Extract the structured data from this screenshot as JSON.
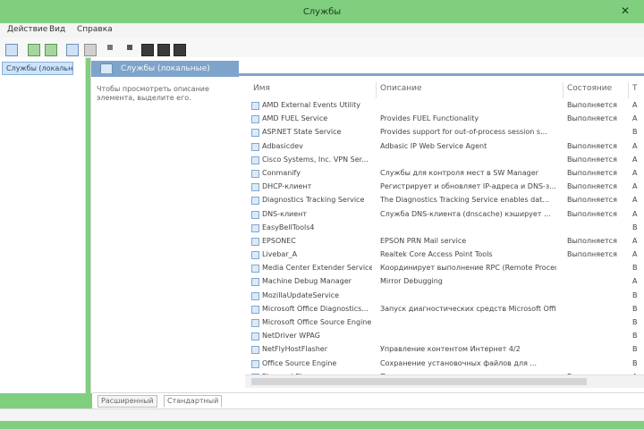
{
  "window": {
    "title": "Службы",
    "menu": [
      "Действие",
      "Вид",
      "Справка"
    ]
  },
  "left_pane": {
    "selected_item": "Службы (локальные)"
  },
  "main": {
    "header": "Службы (локальные)",
    "description": "Чтобы просмотреть описание элемента, выделите его.",
    "columns": [
      "Имя",
      "Описание",
      "Состояние",
      "Т"
    ],
    "rows": [
      {
        "name": "AMD External Events Utility",
        "desc": "",
        "state": "Выполняется",
        "extra": "А"
      },
      {
        "name": "AMD FUEL Service",
        "desc": "Provides FUEL Functionality",
        "state": "Выполняется",
        "extra": "А"
      },
      {
        "name": "ASP.NET State Service",
        "desc": "Provides support for out-of-process session s...",
        "state": "",
        "extra": "В"
      },
      {
        "name": "Adbasicdev",
        "desc": "Adbasic IP Web Service Agent",
        "state": "Выполняется",
        "extra": "А"
      },
      {
        "name": "Cisco Systems, Inc. VPN Ser...",
        "desc": "",
        "state": "Выполняется",
        "extra": "А"
      },
      {
        "name": "Conmanify",
        "desc": "Службы для контроля мест в SW Manager",
        "state": "Выполняется",
        "extra": "А"
      },
      {
        "name": "DHCP-клиент",
        "desc": "Регистрирует и обновляет IP-адреса и DNS-з...",
        "state": "Выполняется",
        "extra": "А"
      },
      {
        "name": "Diagnostics Tracking Service",
        "desc": "The Diagnostics Tracking Service enables dat...",
        "state": "Выполняется",
        "extra": "А"
      },
      {
        "name": "DNS-клиент",
        "desc": "Служба DNS-клиента (dnscache) кэширует ...",
        "state": "Выполняется",
        "extra": "А"
      },
      {
        "name": "EasyBellTools4",
        "desc": "",
        "state": "",
        "extra": "В"
      },
      {
        "name": "EPSONEC",
        "desc": "EPSON PRN Mail service",
        "state": "Выполняется",
        "extra": "А"
      },
      {
        "name": "Livebar_A",
        "desc": "Realtek Core Access Point Tools",
        "state": "Выполняется",
        "extra": "А"
      },
      {
        "name": "Media Center Extender Service",
        "desc": "Координирует выполнение RPC (Remote Procedure Call) ...",
        "state": "",
        "extra": "В"
      },
      {
        "name": "Machine Debug Manager",
        "desc": "Mirror Debugging",
        "state": "",
        "extra": "А"
      },
      {
        "name": "MozillaUpdateService",
        "desc": "",
        "state": "",
        "extra": "В"
      },
      {
        "name": "Microsoft Office Diagnostics...",
        "desc": "Запуск диагностических средств Microsoft Office",
        "state": "",
        "extra": "В"
      },
      {
        "name": "Microsoft Office Source Engine",
        "desc": "",
        "state": "",
        "extra": "В"
      },
      {
        "name": "NetDriver WPAG",
        "desc": "",
        "state": "",
        "extra": "В"
      },
      {
        "name": "NetFlyHostFlasher",
        "desc": "Управление контентом Интернет 4/2",
        "state": "",
        "extra": "В"
      },
      {
        "name": "Office Source Engine",
        "desc": "Сохранение установочных файлов для ...",
        "state": "",
        "extra": "В"
      },
      {
        "name": "Plug and Play",
        "desc": "Позволяет компьютеру распознавать изм...",
        "state": "Выполняется",
        "extra": "А"
      }
    ]
  },
  "tabs": [
    "Расширенный",
    "Стандартный"
  ],
  "colors": {
    "accent_green": "#7fcf7f",
    "header_blue": "#7fa4cb",
    "selected_blue": "#cfe3f7"
  },
  "icons": {
    "close": "close-icon",
    "service": "service-icon",
    "folder": "folder-icon",
    "play": "play-icon",
    "stop": "stop-icon",
    "pause": "pause-icon"
  }
}
